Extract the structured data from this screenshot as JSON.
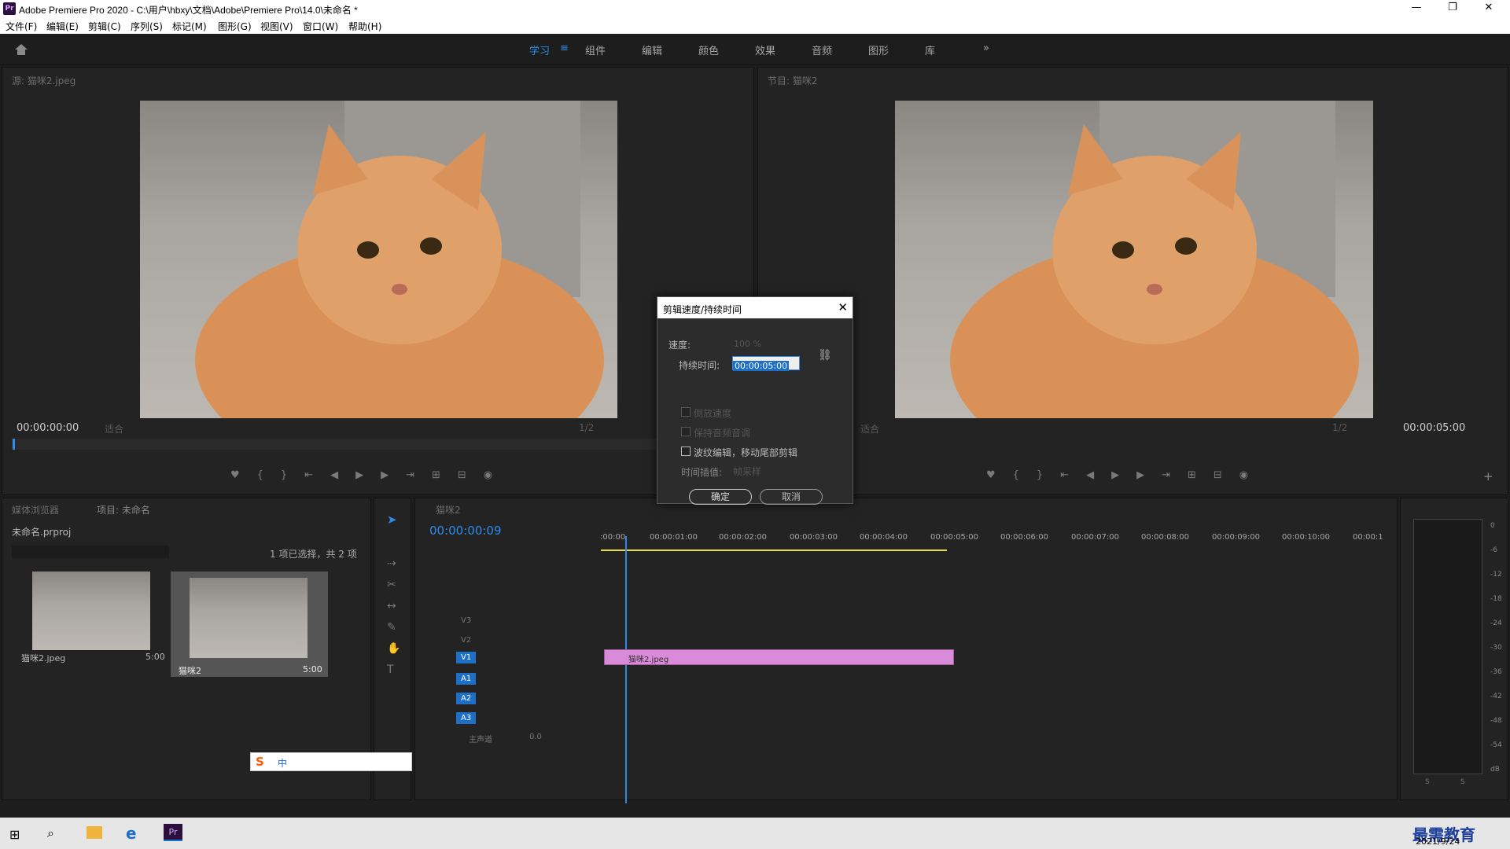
{
  "window": {
    "title": "Adobe Premiere Pro 2020 - C:\\用户\\hbxy\\文档\\Adobe\\Premiere Pro\\14.0\\未命名 *",
    "app_icon": "Pr",
    "minimize": "—",
    "restore": "❐",
    "close": "✕"
  },
  "menu": [
    "文件(F)",
    "编辑(E)",
    "剪辑(C)",
    "序列(S)",
    "标记(M)",
    "图形(G)",
    "视图(V)",
    "窗口(W)",
    "帮助(H)"
  ],
  "workspaces": [
    "学习",
    "组件",
    "编辑",
    "颜色",
    "效果",
    "音频",
    "图形",
    "库"
  ],
  "source_monitor": {
    "title": "源: 猫咪2.jpeg",
    "timecode": "00:00:00:00",
    "fit": "适合",
    "resolution": "1/2"
  },
  "program_monitor": {
    "title": "节目: 猫咪2",
    "timecode": "00:00:05:00",
    "fit": "适合",
    "resolution": "1/2"
  },
  "project_panel": {
    "tab_media": "媒体浏览器",
    "tab_project": "项目: 未命名",
    "project_file": "未命名.prproj",
    "selection_info": "1 项已选择，共 2 项",
    "items": [
      {
        "name": "猫咪2.jpeg",
        "duration": "5:00"
      },
      {
        "name": "猫咪2",
        "duration": "5:00"
      }
    ]
  },
  "timeline": {
    "tab": "猫咪2",
    "timecode": "00:00:00:09",
    "ruler": [
      ":00:00",
      "00:00:01:00",
      "00:00:02:00",
      "00:00:03:00",
      "00:00:04:00",
      "00:00:05:00",
      "00:00:06:00",
      "00:00:07:00",
      "00:00:08:00",
      "00:00:09:00",
      "00:00:10:00",
      "00:00:1"
    ],
    "video_tracks": [
      "V3",
      "V2",
      "V1"
    ],
    "audio_tracks": [
      "A1",
      "A2",
      "A3"
    ],
    "master": "主声道",
    "master_value": "0.0",
    "clip_label": "猫咪2.jpeg",
    "clip_color": "#d98ad9"
  },
  "dialog": {
    "title": "剪辑速度/持续时间",
    "speed_label": "速度:",
    "speed_value": "100 %",
    "duration_label": "持续时间:",
    "duration_value": "00:00:05:00",
    "reverse": "倒放速度",
    "keep_pitch": "保持音频音调",
    "ripple": "波纹编辑，移动尾部剪辑",
    "interp_label": "时间插值:",
    "interp_value": "帧采样",
    "ok": "确定",
    "cancel": "取消"
  },
  "meter_labels": [
    "0",
    "-6",
    "-12",
    "-18",
    "-24",
    "-30",
    "-36",
    "-42",
    "-48",
    "-54",
    "dB"
  ],
  "meter_solo": [
    "S",
    "S"
  ],
  "ime_bar": {
    "logo": "S",
    "mode": "中"
  },
  "taskbar": {
    "date": "2021/9/24",
    "watermark": "最需教育"
  }
}
